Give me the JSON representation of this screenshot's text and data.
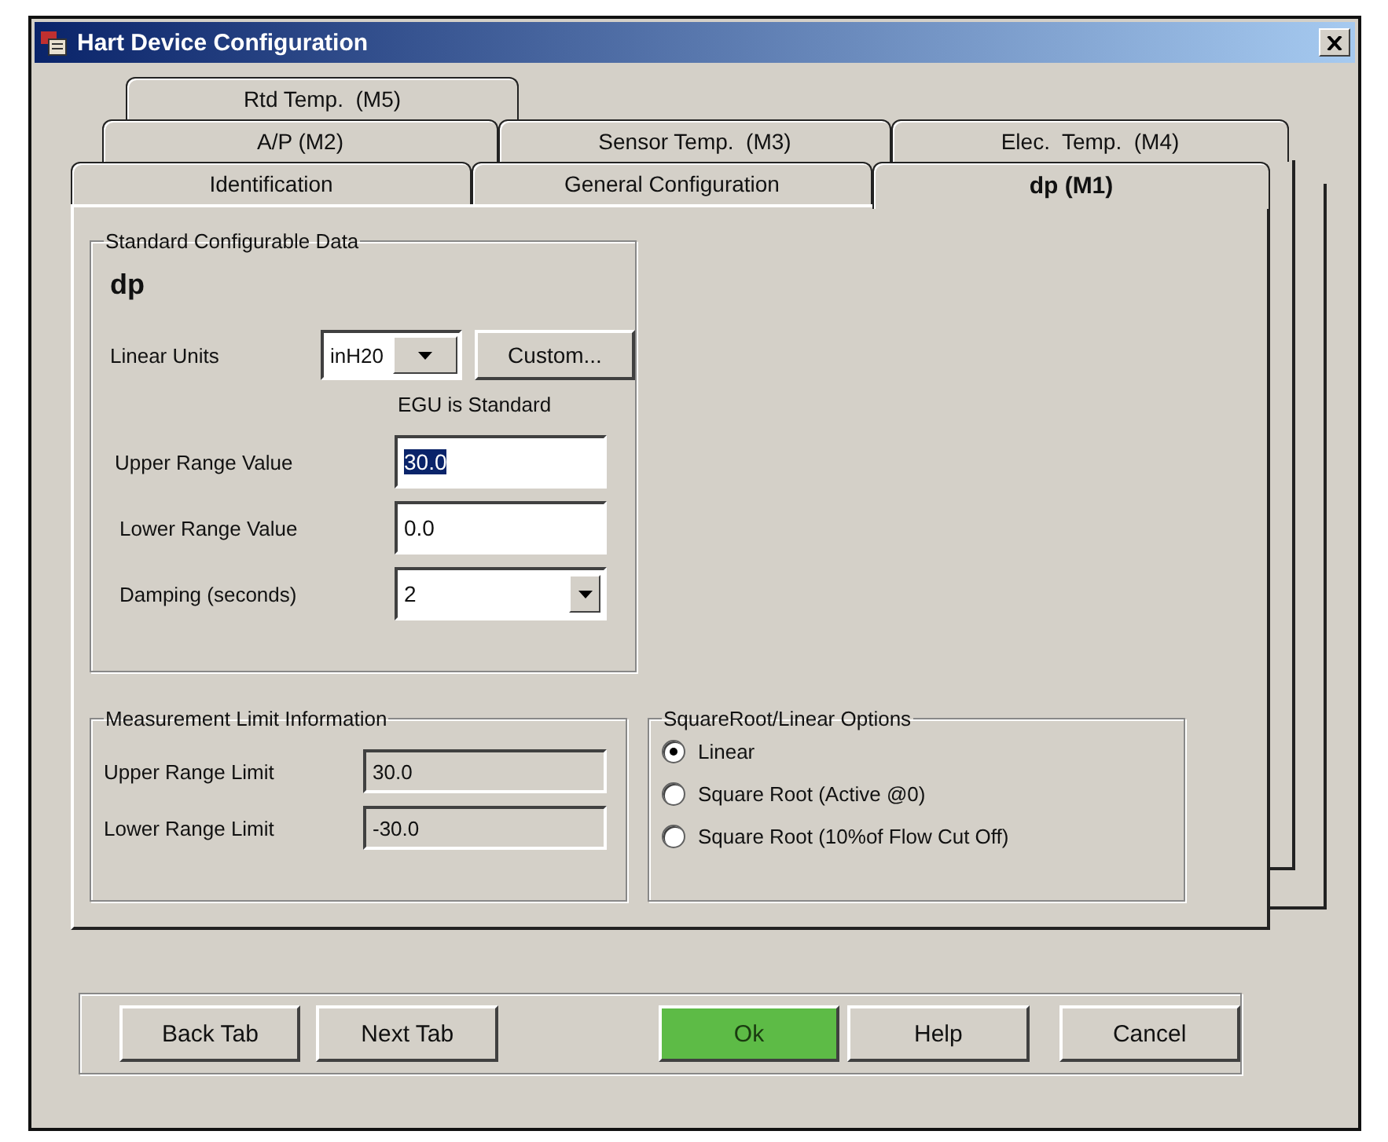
{
  "window": {
    "title": "Hart Device Configuration"
  },
  "tab_rows": [
    [
      {
        "label": "Rtd Temp.  (M5)",
        "selected": false
      }
    ],
    [
      {
        "label": "A/P (M2)",
        "selected": false
      },
      {
        "label": "Sensor Temp.  (M3)",
        "selected": false
      },
      {
        "label": "Elec.  Temp.  (M4)",
        "selected": false
      }
    ],
    [
      {
        "label": "Identification",
        "selected": false
      },
      {
        "label": "General Configuration",
        "selected": false
      },
      {
        "label": "dp (M1)",
        "selected": true
      }
    ]
  ],
  "standard_data": {
    "title": "Standard Configurable Data",
    "name": "dp",
    "linear_units": {
      "label": "Linear Units",
      "value": "inH20"
    },
    "custom_button": "Custom...",
    "egu_note": "EGU is Standard",
    "upper_range_value": {
      "label": "Upper Range Value",
      "value": "30.0",
      "text_selected": true
    },
    "lower_range_value": {
      "label": "Lower Range Value",
      "value": "0.0",
      "text_selected": false
    },
    "damping": {
      "label": "Damping (seconds)",
      "value": "2"
    }
  },
  "measurement_limits": {
    "title": "Measurement Limit Information",
    "fields": [
      {
        "label": "Upper Range Limit",
        "value": "30.0"
      },
      {
        "label": "Lower Range Limit",
        "value": "-30.0"
      }
    ]
  },
  "options": {
    "title": "SquareRoot/Linear Options",
    "items": [
      {
        "label": "Linear",
        "selected": true
      },
      {
        "label": "Square Root (Active @0)",
        "selected": false
      },
      {
        "label": "Square Root (10%of Flow Cut Off)",
        "selected": false
      }
    ]
  },
  "buttons": [
    {
      "label": "Back Tab",
      "default": false
    },
    {
      "label": "Next Tab",
      "default": false
    },
    {
      "label": "Ok",
      "default": true
    },
    {
      "label": "Help",
      "default": false
    },
    {
      "label": "Cancel",
      "default": false
    }
  ]
}
